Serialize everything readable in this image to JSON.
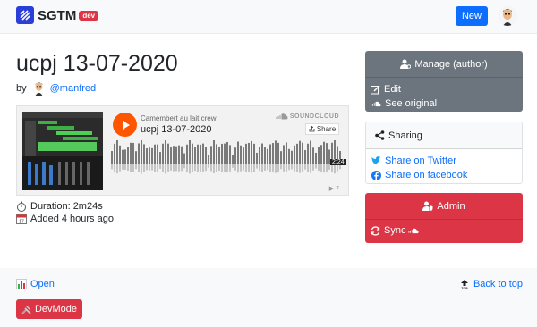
{
  "navbar": {
    "brand": "SGTM",
    "env_badge": "dev",
    "new_label": "New"
  },
  "track": {
    "title": "ucpj 13-07-2020",
    "by_label": "by",
    "author": "@manfred",
    "duration": "Duration: 2m24s",
    "added": "Added 4 hours ago"
  },
  "embed": {
    "artist": "Camembert au lait crew",
    "track_name": "ucpj 13-07-2020",
    "provider": "SOUNDCLOUD",
    "share_label": "Share",
    "duration_tag": "2:24",
    "plays": "▶ 7"
  },
  "manage": {
    "header": "Manage (author)",
    "edit_label": "Edit",
    "see_original_label": "See original"
  },
  "sharing": {
    "header": "Sharing",
    "twitter_label": "Share on Twitter",
    "facebook_label": "Share on facebook"
  },
  "admin": {
    "header": "Admin",
    "sync_label": "Sync"
  },
  "footer": {
    "open_label": "Open",
    "back_to_top_label": "Back to top",
    "devmode_label": "DevMode"
  },
  "colors": {
    "primary": "#0d6efd",
    "danger": "#dc3545",
    "secondary": "#6c757d",
    "soundcloud": "#ff5500"
  },
  "icons": {
    "brand": "sgtm-logo-icon",
    "manage": "user-gear-icon",
    "edit": "edit-icon",
    "soundcloud": "soundcloud-icon",
    "sharing": "share-icon",
    "twitter": "twitter-icon",
    "facebook": "facebook-icon",
    "admin": "user-shield-icon",
    "sync": "sync-icon",
    "stopwatch": "stopwatch-icon",
    "calendar": "calendar-icon",
    "chart": "bar-chart-icon",
    "top": "back-to-top-icon",
    "tools": "tools-icon"
  }
}
